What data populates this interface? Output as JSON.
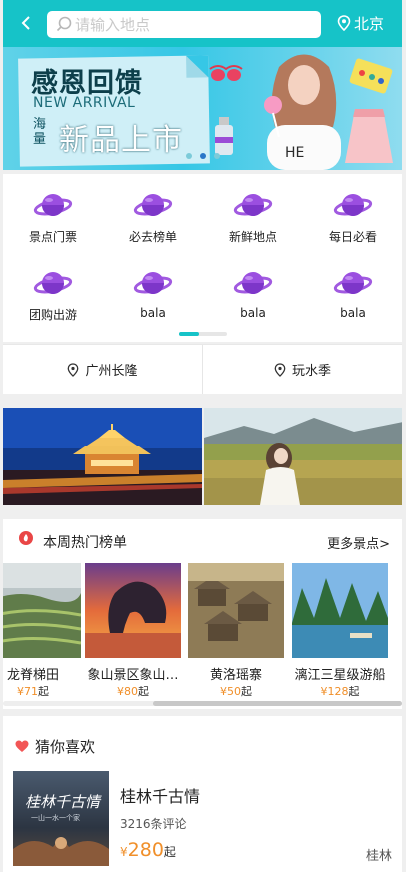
{
  "header": {
    "search_placeholder": "请输入地点",
    "city": "北京",
    "colors": {
      "accent": "#16c3c8"
    }
  },
  "banner": {
    "title": "感恩回馈",
    "subtitle": "NEW ARRIVAL",
    "side_text": "海量",
    "main_text": "新品上市",
    "slides": 3,
    "active_slide": 2
  },
  "categories": [
    {
      "label": "景点门票",
      "icon": "planet-icon"
    },
    {
      "label": "必去榜单",
      "icon": "planet-icon"
    },
    {
      "label": "新鲜地点",
      "icon": "planet-icon"
    },
    {
      "label": "每日必看",
      "icon": "planet-icon"
    },
    {
      "label": "团购出游",
      "icon": "planet-icon"
    },
    {
      "label": "bala",
      "icon": "planet-icon"
    },
    {
      "label": "bala",
      "icon": "planet-icon"
    },
    {
      "label": "bala",
      "icon": "planet-icon"
    }
  ],
  "locations": [
    {
      "label": "广州长隆",
      "icon": "location-pin-icon"
    },
    {
      "label": "玩水季",
      "icon": "location-pin-icon"
    }
  ],
  "hot": {
    "title": "本周热门榜单",
    "more": "更多景点>",
    "items": [
      {
        "name": "龙脊梯田",
        "currency": "¥",
        "price": "71",
        "unit": "起"
      },
      {
        "name": "象山景区象山…",
        "currency": "¥",
        "price": "80",
        "unit": "起"
      },
      {
        "name": "黄洛瑶寨",
        "currency": "¥",
        "price": "50",
        "unit": "起"
      },
      {
        "name": "漓江三星级游船",
        "currency": "¥",
        "price": "128",
        "unit": "起"
      }
    ]
  },
  "guess": {
    "title": "猜你喜欢",
    "card": {
      "name": "桂林千古情",
      "reviews": "3216条评论",
      "currency": "¥",
      "price": "280",
      "unit": "起",
      "city": "桂林",
      "image_text": "桂林千古情",
      "image_sub": "一山一水一个家"
    }
  }
}
